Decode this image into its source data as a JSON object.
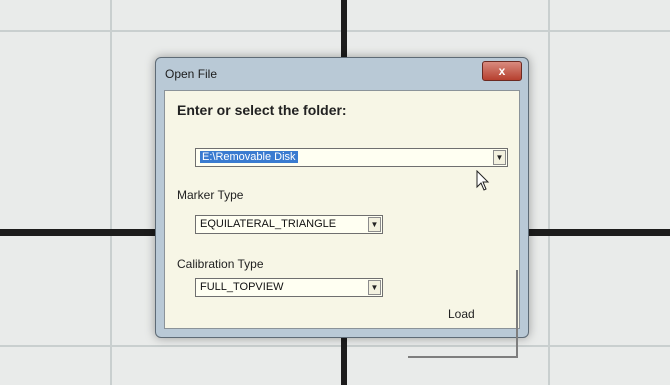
{
  "window": {
    "title": "Open File",
    "close_label": "x"
  },
  "dialog": {
    "heading": "Enter or select the folder:",
    "folder": {
      "value": "E:\\Removable Disk"
    },
    "marker_type": {
      "label": "Marker Type",
      "value": "EQUILATERAL_TRIANGLE"
    },
    "calibration_type": {
      "label": "Calibration Type",
      "value": "FULL_TOPVIEW"
    },
    "load_label": "Load"
  },
  "icons": {
    "dropdown": "chevron-down-icon",
    "cursor": "mouse-pointer-icon"
  }
}
